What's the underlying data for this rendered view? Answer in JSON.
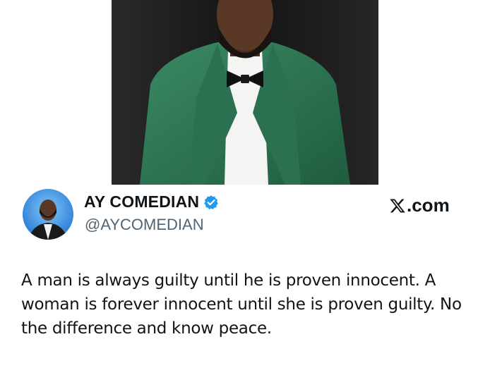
{
  "tweet": {
    "display_name": "AY COMEDIAN",
    "handle": "@AYCOMEDIAN",
    "verified": true,
    "source_label": ".com",
    "source_icon": "x-logo-icon",
    "text": "A man is always guilty until he is proven innocent. A woman is forever innocent until she is proven guilty. No the difference and know peace."
  },
  "colors": {
    "verified_blue": "#1d9bf0",
    "text": "#0f1419",
    "handle_gray": "#536471",
    "suit_green": "#2e7a57"
  }
}
